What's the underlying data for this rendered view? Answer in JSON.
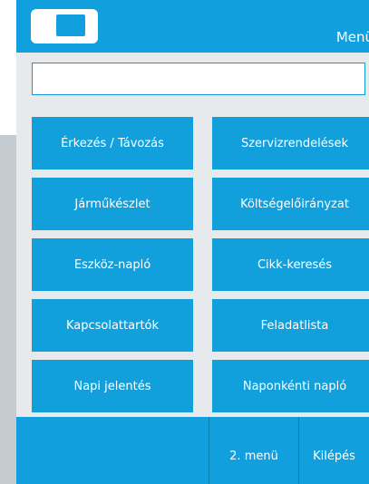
{
  "header": {
    "title": "Menü",
    "logo": "device-logo-icon"
  },
  "search": {
    "value": "",
    "placeholder": ""
  },
  "menu": {
    "items": [
      {
        "label": "Érkezés / Távozás"
      },
      {
        "label": "Szervizrendelések"
      },
      {
        "label": "Járműkészlet"
      },
      {
        "label": "Költségelőirányzat"
      },
      {
        "label": "Eszköz-napló"
      },
      {
        "label": "Cikk-keresés"
      },
      {
        "label": "Kapcsolattartók"
      },
      {
        "label": "Feladatlista"
      },
      {
        "label": "Napi jelentés"
      },
      {
        "label": "Naponkénti napló"
      }
    ]
  },
  "footer": {
    "menu2_label": "2. menü",
    "exit_label": "Kilépés"
  },
  "colors": {
    "accent": "#11a0dd",
    "background": "#e6eaec",
    "bezel": "#c3cbd1"
  }
}
